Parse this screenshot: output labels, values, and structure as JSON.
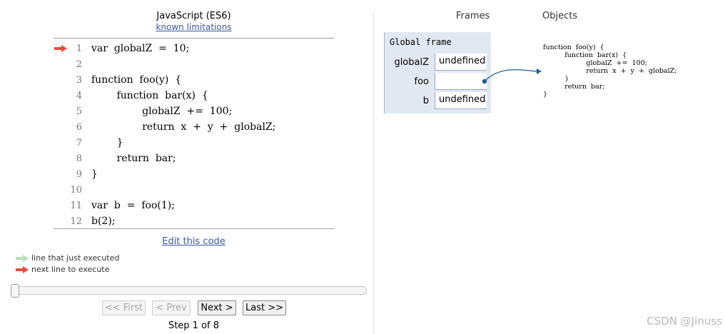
{
  "header": {
    "language": "JavaScript (ES6)",
    "limitations_link": "known limitations"
  },
  "code": {
    "current_line": 1,
    "arrow_color": "#e74c3c",
    "lines": [
      {
        "num": "1",
        "text": "var  globalZ  =  10;"
      },
      {
        "num": "2",
        "text": ""
      },
      {
        "num": "3",
        "text": "function  foo(y)  {"
      },
      {
        "num": "4",
        "text": "        function  bar(x)  {"
      },
      {
        "num": "5",
        "text": "                globalZ  +=  100;"
      },
      {
        "num": "6",
        "text": "                return  x  +  y  +  globalZ;"
      },
      {
        "num": "7",
        "text": "        }"
      },
      {
        "num": "8",
        "text": "        return  bar;"
      },
      {
        "num": "9",
        "text": "}"
      },
      {
        "num": "10",
        "text": ""
      },
      {
        "num": "11",
        "text": "var  b  =  foo(1);"
      },
      {
        "num": "12",
        "text": "b(2);"
      }
    ]
  },
  "edit_link": "Edit this code",
  "legend": {
    "executed": {
      "label": "line that just executed",
      "color": "#b7e0b7"
    },
    "next": {
      "label": "next line to execute",
      "color": "#e74c3c"
    }
  },
  "controls": {
    "first": "<< First",
    "prev": "< Prev",
    "next": "Next >",
    "last": "Last >>",
    "step_text": "Step 1 of 8",
    "progress_fraction": 0.0
  },
  "viz": {
    "frames_heading": "Frames",
    "objects_heading": "Objects",
    "global_frame": {
      "title": "Global frame",
      "vars": [
        {
          "name": "globalZ",
          "value": "undefined"
        },
        {
          "name": "foo",
          "value": ""
        },
        {
          "name": "b",
          "value": "undefined"
        }
      ]
    },
    "function_object": "function  foo(y)  {\n          function  bar(x)  {\n                    globalZ  +=  100;\n                    return  x  +  y  +  globalZ;\n          }\n          return  bar;\n}",
    "pointer_color": "#1a5f8c"
  },
  "watermark": "CSDN @Jinuss"
}
